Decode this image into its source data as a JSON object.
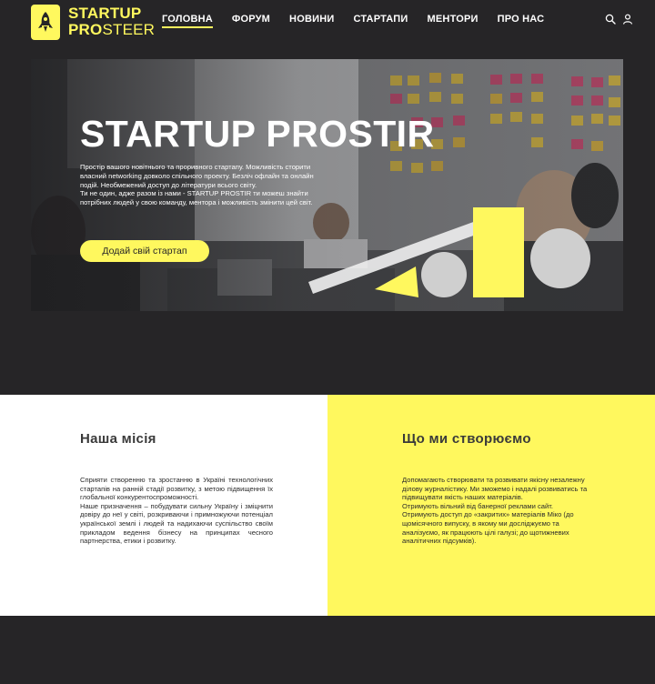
{
  "brand": {
    "line1": "STARTUP",
    "line2_pro": "PRO",
    "line2_steer": "STEER",
    "accent": "#fff85e",
    "dark": "#262527"
  },
  "nav": {
    "items": [
      "ГОЛОВНА",
      "ФОРУМ",
      "НОВИНИ",
      "СТАРТАПИ",
      "МЕНТОРИ",
      "ПРО НАС"
    ],
    "active": "ГОЛОВНА"
  },
  "header_icons": [
    "search-icon",
    "user-icon"
  ],
  "hero": {
    "title": "STARTUP PROSTIR",
    "description_lines": [
      "Простір вашого новітнього та проривного стартапу.  Можливість сторити",
      "власний networking довколо спільного проекту. Безліч офлайн та онлайн",
      "подій. Необмежений доступ до літератури всього світу.",
      "Ти не один, адже разом із нами - STARTUP PROSTIR ти можеш знайти",
      "потрібних людей у свою команду, ментора і можливість змінити цей світ."
    ],
    "cta": "Додай свій стартап"
  },
  "mission": {
    "title": "Наша місія",
    "lines": [
      "Сприяти створенню та зростанню в Україні технологічних стартапів на ранній стадії розвитку, з метою підвищення їх глобальної конкурентоспроможності.",
      "Наше призначення – побудувати сильну Україну і зміцнити довіру до неї у світі, розкриваючи і примножуючи потенціал української землі і людей та надихаючи суспільство своїм прикладом ведення бізнесу на принципах чесного партнерства, етики і розвитку."
    ]
  },
  "create": {
    "title": "Що ми створюємо",
    "lines": [
      "Допомагають створювати та розвивати якісну незалежну ділову журналістику. Ми зможемо і надалі розвиватись та підвищувати якість наших матеріалів.",
      "Отримують вільний від банерної реклами сайт.",
      "Отримують доступ до «закритих» матеріалів Міко (до щомісячного випуску, в якому ми досліджуємо та аналізуємо, як працюють цілі галузі; до щотижневих аналітичних підсумків)."
    ]
  }
}
